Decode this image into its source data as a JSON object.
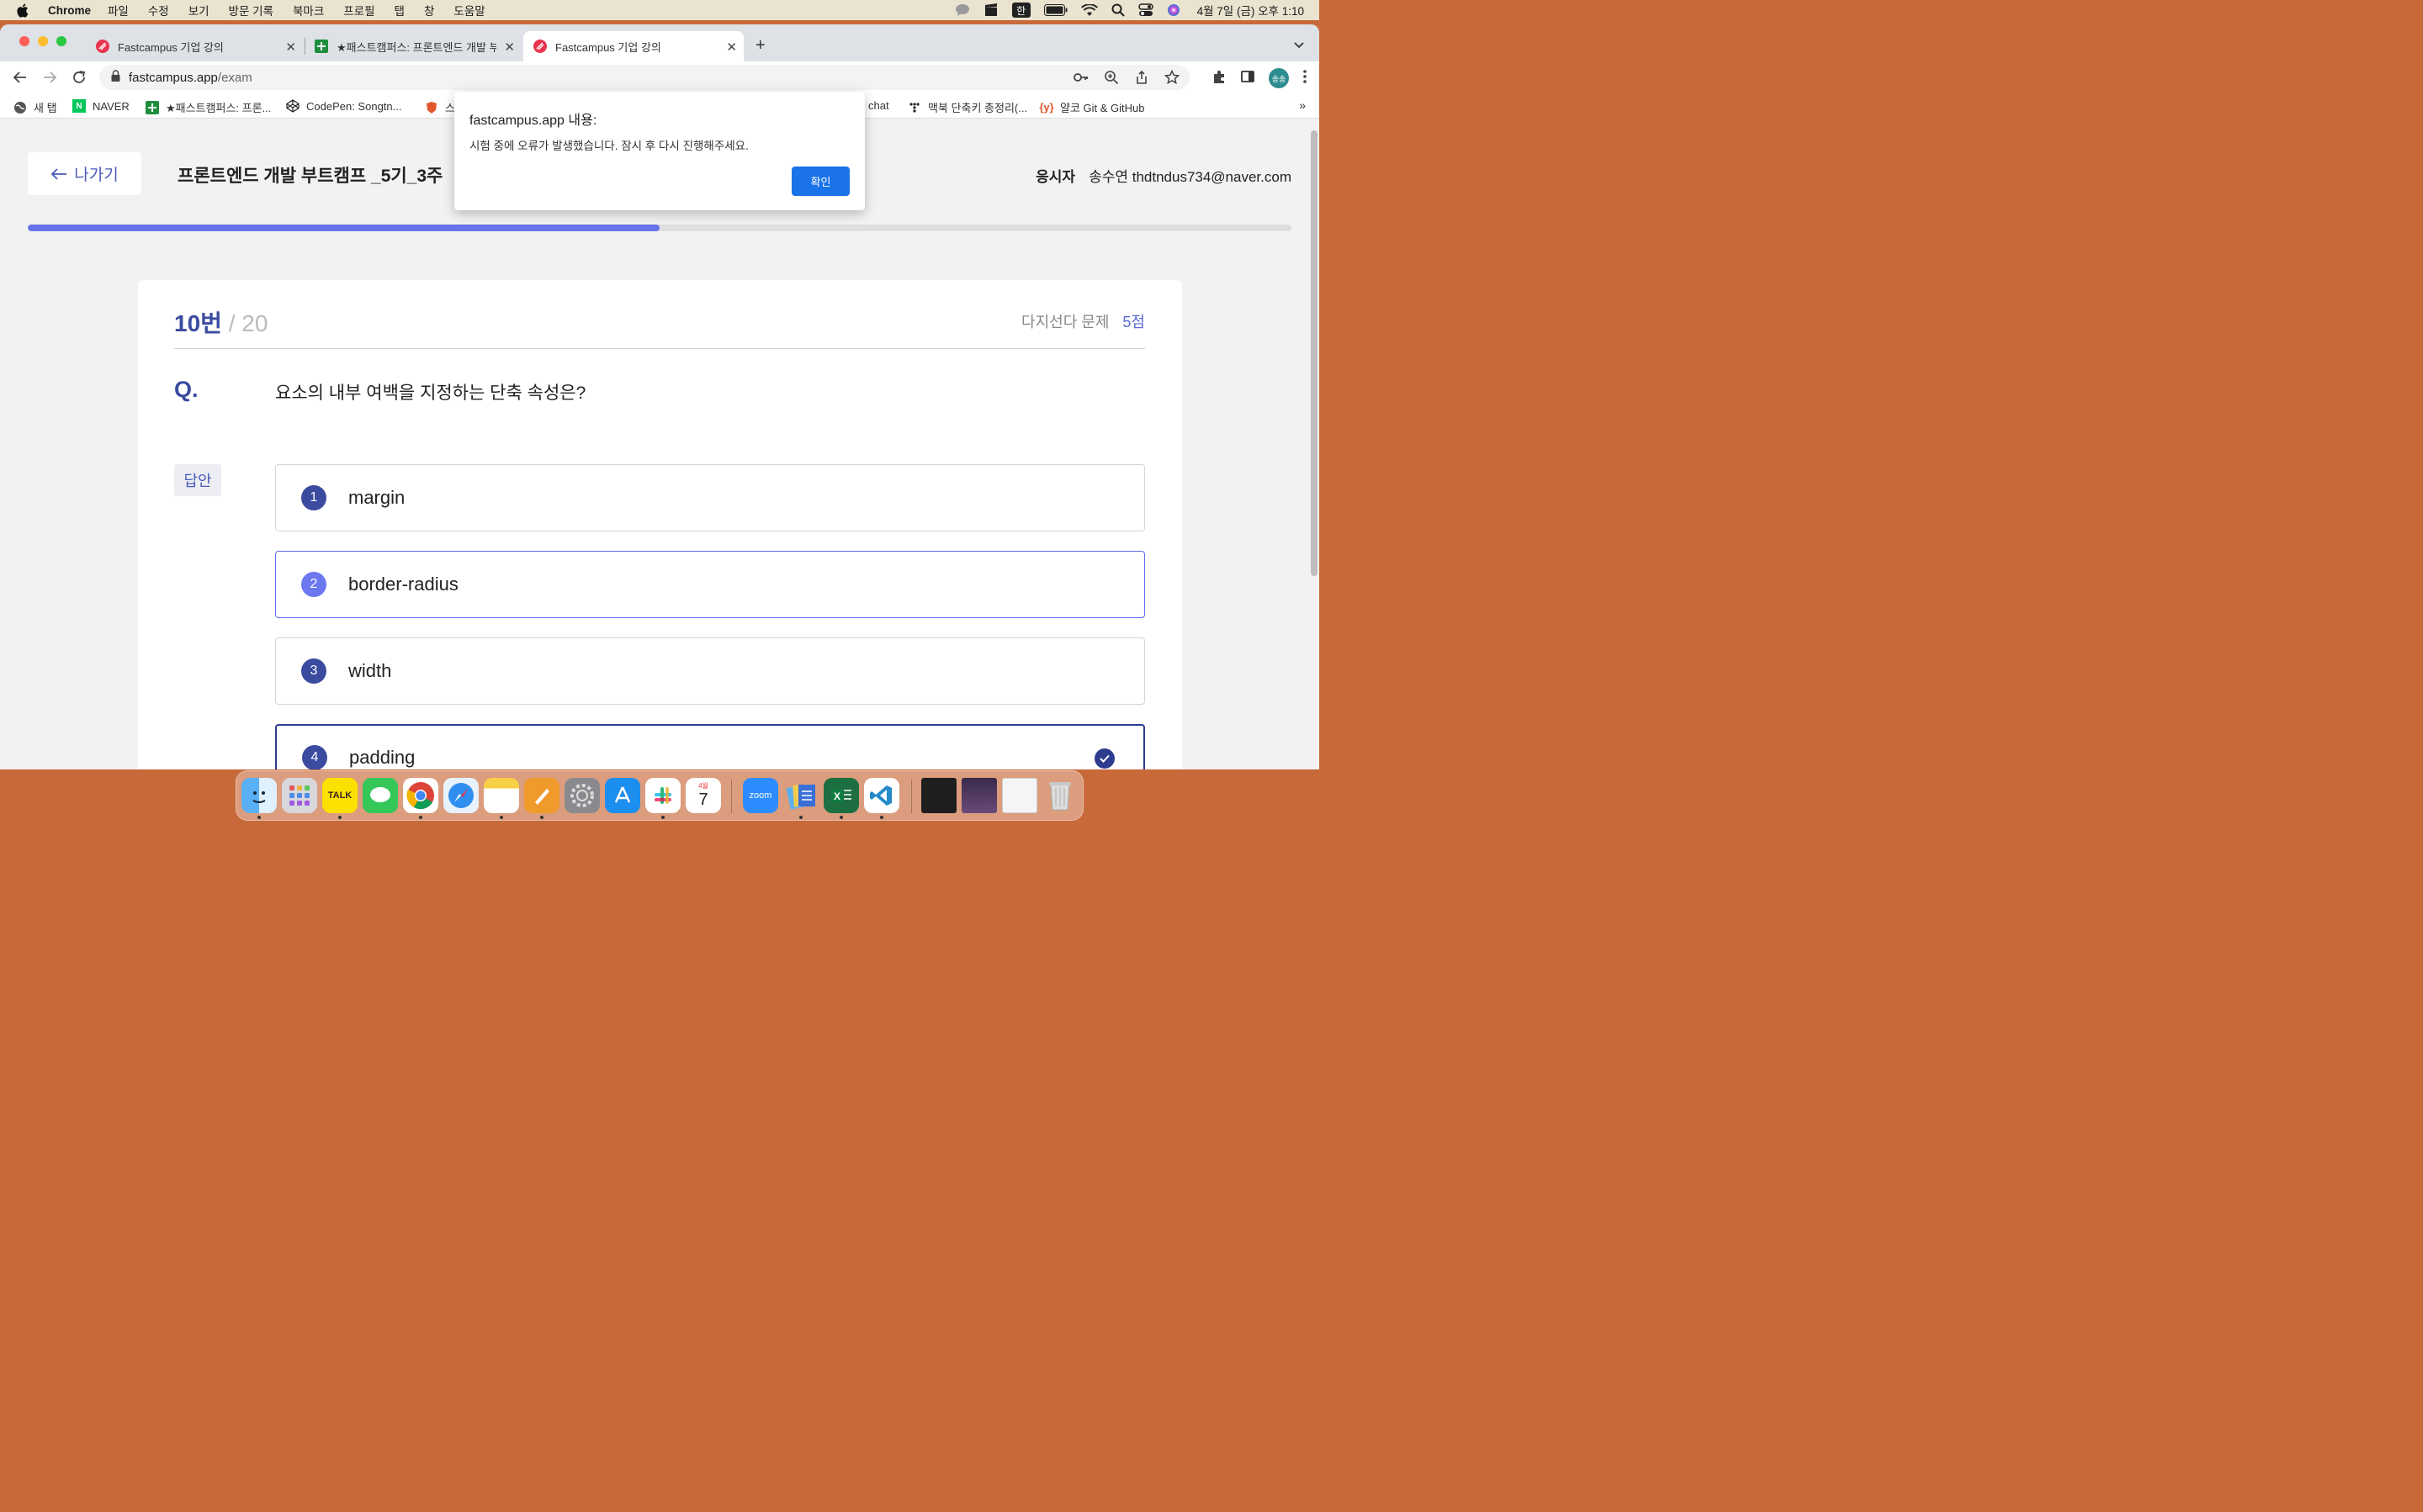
{
  "menubar": {
    "app_name": "Chrome",
    "items": [
      "파일",
      "수정",
      "보기",
      "방문 기록",
      "북마크",
      "프로필",
      "탭",
      "창",
      "도움말"
    ],
    "ime": "한",
    "clock": "4월 7일 (금) 오후 1:10"
  },
  "tabs": [
    {
      "title": "Fastcampus 기업 강의",
      "icon": "fastcampus-icon",
      "active": false
    },
    {
      "title": "★패스트캠퍼스: 프론트엔드 개발 부트",
      "icon": "sheets-icon",
      "active": false
    },
    {
      "title": "Fastcampus 기업 강의",
      "icon": "fastcampus-icon",
      "active": true
    }
  ],
  "address": {
    "host": "fastcampus.app",
    "path": "/exam"
  },
  "profile": {
    "initials": "송송"
  },
  "bookmarks": [
    {
      "label": "새 탭",
      "icon": "globe-icon"
    },
    {
      "label": "NAVER",
      "icon": "naver-icon"
    },
    {
      "label": "★패스트캠퍼스: 프론...",
      "icon": "sheets-icon"
    },
    {
      "label": "CodePen:  Songtn...",
      "icon": "codepen-icon"
    },
    {
      "label": "스",
      "icon": "shield-icon"
    },
    {
      "label": "chat",
      "icon": ""
    },
    {
      "label": "맥북 단축키 총정리(...",
      "icon": "tree-icon"
    },
    {
      "label": "얄코 Git & GitHub",
      "icon": "yalco-icon"
    }
  ],
  "page": {
    "exit_label": "나가기",
    "course_title": "프론트엔드 개발 부트캠프 _5기_3주",
    "examinee_label": "응시자",
    "examinee_value": "송수연 thdtndus734@naver.com",
    "progress_fraction": 0.5,
    "question": {
      "number": "10번",
      "total": "/ 20",
      "type": "다지선다 문제",
      "score": "5점",
      "label": "Q.",
      "text": "요소의 내부 여백을 지정하는 단축 속성은?",
      "answer_tag": "답안",
      "options": [
        {
          "num": "1",
          "text": "margin",
          "state": "normal"
        },
        {
          "num": "2",
          "text": "border-radius",
          "state": "hover"
        },
        {
          "num": "3",
          "text": "width",
          "state": "normal"
        },
        {
          "num": "4",
          "text": "padding",
          "state": "selected"
        }
      ]
    }
  },
  "dialog": {
    "title": "fastcampus.app 내용:",
    "message": "시험 중에 오류가 발생했습니다. 잠시 후 다시 진행해주세요.",
    "ok_label": "확인"
  },
  "dock": {
    "calendar_month": "4월",
    "calendar_day": "7",
    "talk_label": "TALK",
    "zoom_label": "zoom"
  },
  "colors": {
    "accent": "#3b4ba0",
    "progress": "#6673ea",
    "dialog_button": "#1a73e8"
  }
}
